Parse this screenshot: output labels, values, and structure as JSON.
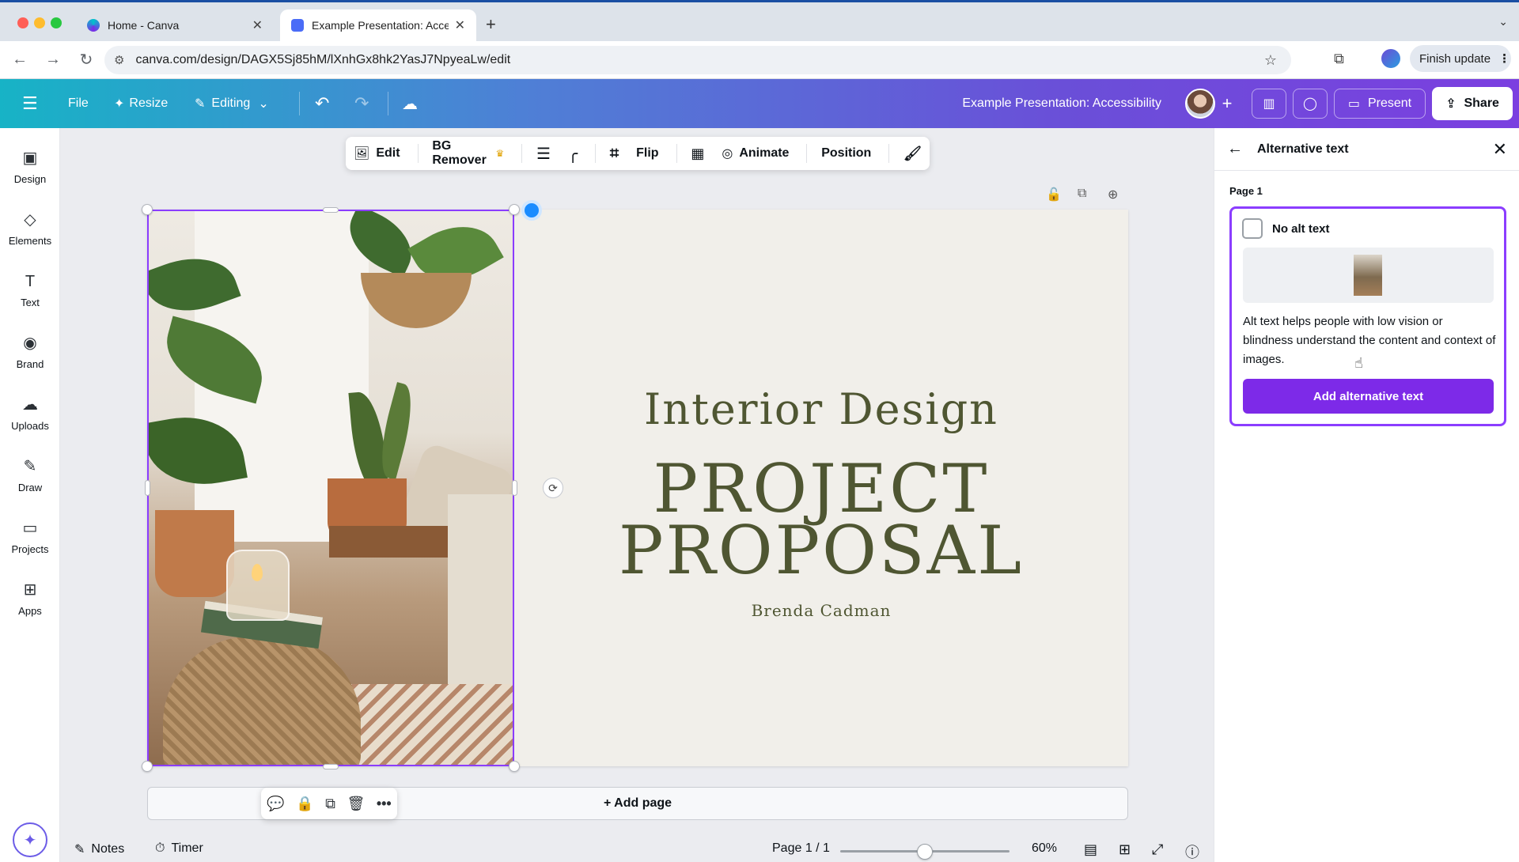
{
  "browser": {
    "tabs": [
      {
        "title": "Home - Canva",
        "active": false
      },
      {
        "title": "Example Presentation: Acces",
        "active": true
      }
    ],
    "url": "canva.com/design/DAGX5Sj85hM/lXnhGx8hk2YasJ7NpyeaLw/edit",
    "finish_update": "Finish update"
  },
  "header": {
    "file": "File",
    "resize": "Resize",
    "editing": "Editing",
    "doc_title": "Example Presentation: Accessibility",
    "present": "Present",
    "share": "Share",
    "accent": "#7d2ae8"
  },
  "rail": {
    "items": [
      {
        "label": "Design",
        "icon": "design-icon"
      },
      {
        "label": "Elements",
        "icon": "elements-icon"
      },
      {
        "label": "Text",
        "icon": "text-icon"
      },
      {
        "label": "Brand",
        "icon": "brand-icon"
      },
      {
        "label": "Uploads",
        "icon": "uploads-icon"
      },
      {
        "label": "Draw",
        "icon": "draw-icon"
      },
      {
        "label": "Projects",
        "icon": "folder-icon"
      },
      {
        "label": "Apps",
        "icon": "apps-icon"
      }
    ]
  },
  "context_toolbar": {
    "edit": "Edit",
    "bg_remover": "BG Remover",
    "flip": "Flip",
    "animate": "Animate",
    "position": "Position"
  },
  "slide": {
    "heading": "Interior Design",
    "line1": "PROJECT",
    "line2": "PROPOSAL",
    "author": "Brenda Cadman",
    "text_color": "#4f5632"
  },
  "canvas": {
    "add_page": "+ Add page"
  },
  "bottombar": {
    "notes": "Notes",
    "timer": "Timer",
    "page_indicator": "Page 1 / 1",
    "zoom": "60%",
    "zoom_fraction": 0.6
  },
  "panel": {
    "title": "Alternative text",
    "page_label": "Page 1",
    "no_alt": "No alt text",
    "description": "Alt text helps people with low vision or blindness understand the content and context of images.",
    "add_button": "Add alternative text"
  }
}
